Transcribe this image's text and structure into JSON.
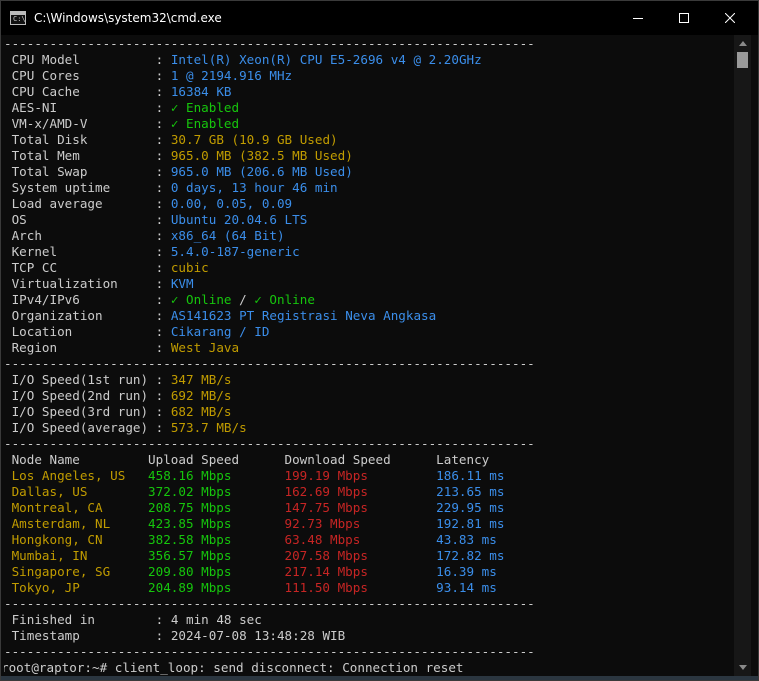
{
  "window": {
    "title": "C:\\Windows\\system32\\cmd.exe",
    "icon_text": "C:\\"
  },
  "colors": {
    "white": "#cccccc",
    "blue": "#3b8eea",
    "yellow": "#c19c00",
    "green": "#16c60c",
    "red": "#c72524"
  },
  "separator": "----------------------------------------------------------------------",
  "sysinfo": [
    {
      "label": " CPU Model          ",
      "value": "Intel(R) Xeon(R) CPU E5-2696 v4 @ 2.20GHz",
      "color": "blue"
    },
    {
      "label": " CPU Cores          ",
      "value": "1 @ 2194.916 MHz",
      "color": "blue"
    },
    {
      "label": " CPU Cache          ",
      "value": "16384 KB",
      "color": "blue"
    },
    {
      "label": " AES-NI             ",
      "value": "✓ Enabled",
      "color": "green"
    },
    {
      "label": " VM-x/AMD-V         ",
      "value": "✓ Enabled",
      "color": "green"
    },
    {
      "label": " Total Disk         ",
      "value": "30.7 GB (10.9 GB Used)",
      "color": "yellow"
    },
    {
      "label": " Total Mem          ",
      "value": "965.0 MB (382.5 MB Used)",
      "color": "yellow"
    },
    {
      "label": " Total Swap         ",
      "value": "965.0 MB (206.6 MB Used)",
      "color": "blue"
    },
    {
      "label": " System uptime      ",
      "value": "0 days, 13 hour 46 min",
      "color": "blue"
    },
    {
      "label": " Load average       ",
      "value": "0.00, 0.05, 0.09",
      "color": "blue"
    },
    {
      "label": " OS                 ",
      "value": "Ubuntu 20.04.6 LTS",
      "color": "blue"
    },
    {
      "label": " Arch               ",
      "value": "x86_64 (64 Bit)",
      "color": "blue"
    },
    {
      "label": " Kernel             ",
      "value": "5.4.0-187-generic",
      "color": "blue"
    },
    {
      "label": " TCP CC             ",
      "value": "cubic",
      "color": "yellow"
    },
    {
      "label": " Virtualization     ",
      "value": "KVM",
      "color": "blue"
    },
    {
      "label": " IPv4/IPv6          ",
      "value": "✓ Online",
      "sep": " / ",
      "value2": "✓ Online",
      "color": "green"
    },
    {
      "label": " Organization       ",
      "value": "AS141623 PT Registrasi Neva Angkasa",
      "color": "blue"
    },
    {
      "label": " Location           ",
      "value": "Cikarang / ID",
      "color": "blue"
    },
    {
      "label": " Region             ",
      "value": "West Java",
      "color": "yellow"
    }
  ],
  "io": [
    {
      "label": " I/O Speed(1st run) ",
      "value": "347 MB/s"
    },
    {
      "label": " I/O Speed(2nd run) ",
      "value": "692 MB/s"
    },
    {
      "label": " I/O Speed(3rd run) ",
      "value": "682 MB/s"
    },
    {
      "label": " I/O Speed(average) ",
      "value": "573.7 MB/s"
    }
  ],
  "speedtest": {
    "headers": [
      " Node Name",
      "Upload Speed",
      "Download Speed",
      "Latency"
    ],
    "rows": [
      {
        "node": " Los Angeles, US",
        "upload": "458.16 Mbps",
        "download": "199.19 Mbps",
        "latency": "186.11 ms"
      },
      {
        "node": " Dallas, US",
        "upload": "372.02 Mbps",
        "download": "162.69 Mbps",
        "latency": "213.65 ms"
      },
      {
        "node": " Montreal, CA",
        "upload": "208.75 Mbps",
        "download": "147.75 Mbps",
        "latency": "229.95 ms"
      },
      {
        "node": " Amsterdam, NL",
        "upload": "423.85 Mbps",
        "download": "92.73 Mbps",
        "latency": "192.81 ms"
      },
      {
        "node": " Hongkong, CN",
        "upload": "382.58 Mbps",
        "download": "63.48 Mbps",
        "latency": "43.83 ms"
      },
      {
        "node": " Mumbai, IN",
        "upload": "356.57 Mbps",
        "download": "207.58 Mbps",
        "latency": "172.82 ms"
      },
      {
        "node": " Singapore, SG",
        "upload": "209.80 Mbps",
        "download": "217.14 Mbps",
        "latency": "16.39 ms"
      },
      {
        "node": " Tokyo, JP",
        "upload": "204.89 Mbps",
        "download": "111.50 Mbps",
        "latency": "93.14 ms"
      }
    ]
  },
  "footer": [
    {
      "label": " Finished in        ",
      "value": "4 min 48 sec"
    },
    {
      "label": " Timestamp          ",
      "value": "2024-07-08 13:48:28 WIB"
    }
  ],
  "colon": ": ",
  "prompt": {
    "text": "root@raptor:~# ",
    "message": "client_loop: send disconnect: Connection reset"
  }
}
